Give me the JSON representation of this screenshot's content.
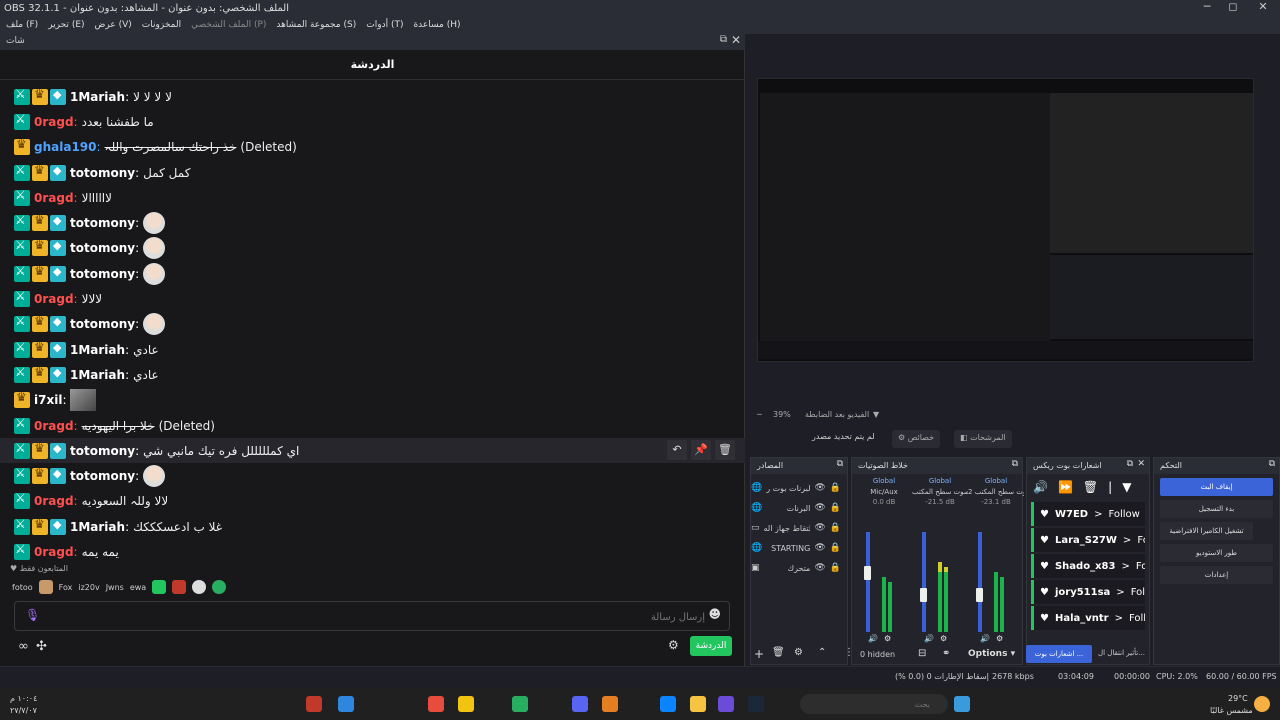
{
  "window": {
    "title": "OBS 32.1.1 - الملف الشخصي: بدون عنوان - المشاهد: بدون عنوان"
  },
  "menu": [
    "ملف (F)",
    "تحرير (E)",
    "عرض (V)",
    "المخزونات",
    "الملف الشخصي (P)",
    "مجموعة المشاهد (S)",
    "أدوات (T)",
    "مساعدة (H)"
  ],
  "chat_dock": {
    "dock_title": "شات",
    "header": "الدردشة",
    "messages": [
      {
        "badges": [
          "mod",
          "crown",
          "vip"
        ],
        "user": "1Mariah",
        "color": "#ffffff",
        "text": "لا لا لا لا",
        "deleted": false
      },
      {
        "badges": [
          "mod"
        ],
        "user": "0ragd",
        "color": "#ff4f4f",
        "text": "ما طفشنا بعدد",
        "deleted": false
      },
      {
        "badges": [
          "crown"
        ],
        "user": "ghala190",
        "color": "#4fa3ff",
        "text": "خذ راحتك سالمصرت واللہ",
        "deleted": true
      },
      {
        "badges": [
          "mod",
          "crown",
          "vip"
        ],
        "user": "totomony",
        "color": "#ffffff",
        "text": "كمل كمل",
        "deleted": false
      },
      {
        "badges": [
          "mod"
        ],
        "user": "0ragd",
        "color": "#ff4f4f",
        "text": "لاااااالا",
        "deleted": false
      },
      {
        "badges": [
          "mod",
          "crown",
          "vip"
        ],
        "user": "totomony",
        "color": "#ffffff",
        "text": "",
        "emote": true,
        "deleted": false
      },
      {
        "badges": [
          "mod",
          "crown",
          "vip"
        ],
        "user": "totomony",
        "color": "#ffffff",
        "text": "",
        "emote": true,
        "deleted": false
      },
      {
        "badges": [
          "mod",
          "crown",
          "vip"
        ],
        "user": "totomony",
        "color": "#ffffff",
        "text": "",
        "emote": true,
        "deleted": false
      },
      {
        "badges": [
          "mod"
        ],
        "user": "0ragd",
        "color": "#ff4f4f",
        "text": "لالالا",
        "deleted": false
      },
      {
        "badges": [
          "mod",
          "crown",
          "vip"
        ],
        "user": "totomony",
        "color": "#ffffff",
        "text": "",
        "emote": true,
        "deleted": false
      },
      {
        "badges": [
          "mod",
          "crown",
          "vip"
        ],
        "user": "1Mariah",
        "color": "#ffffff",
        "text": "عادي",
        "deleted": false
      },
      {
        "badges": [
          "mod",
          "crown",
          "vip"
        ],
        "user": "1Mariah",
        "color": "#ffffff",
        "text": "عادي",
        "deleted": false
      },
      {
        "badges": [
          "crown"
        ],
        "user": "i7xil",
        "color": "#ffffff",
        "text": "",
        "pic": true,
        "deleted": false
      },
      {
        "badges": [
          "mod"
        ],
        "user": "0ragd",
        "color": "#ff4f4f",
        "text": "خلا برا اليهوديه",
        "deleted": true
      },
      {
        "badges": [
          "mod",
          "crown",
          "vip"
        ],
        "user": "totomony",
        "color": "#ffffff",
        "text": "اي كملللللل فره تيك مانبي شي",
        "deleted": false,
        "highlight": true
      },
      {
        "badges": [
          "mod",
          "crown",
          "vip"
        ],
        "user": "totomony",
        "color": "#ffffff",
        "text": "",
        "emote": true,
        "deleted": false
      },
      {
        "badges": [
          "mod"
        ],
        "user": "0ragd",
        "color": "#ff4f4f",
        "text": "لالا وللہ السعوديه",
        "deleted": false
      },
      {
        "badges": [
          "mod",
          "crown",
          "vip"
        ],
        "user": "1Mariah",
        "color": "#ffffff",
        "text": "غلا ب ادعسكككك",
        "deleted": false
      },
      {
        "badges": [
          "mod"
        ],
        "user": "0ragd",
        "color": "#ff4f4f",
        "text": "يمه يمه",
        "deleted": false
      }
    ],
    "deleted_tag": "(Deleted)",
    "subs_label": "المتابعون فقط",
    "emote_row": [
      "fotoo",
      "Fox",
      "iz20v",
      "Jwns",
      "ewa"
    ],
    "input_placeholder": "إرسال رسالة",
    "send_button": "الدردشة"
  },
  "preview": {
    "zoom": "39%",
    "zoom_hint": "الفيديو بعد الضابطة"
  },
  "controls_row": {
    "no_source": "لم يتم تحديد مصدر",
    "props": "خصائص",
    "filters": "المرشحات"
  },
  "sources": {
    "title": "المصادر",
    "items": [
      {
        "name": "البرنات بوت ر",
        "type": "browser"
      },
      {
        "name": "البرنات",
        "type": "browser"
      },
      {
        "name": "التقاط جهاز اله",
        "type": "window"
      },
      {
        "name": "STARTING",
        "type": "browser"
      },
      {
        "name": "متحرك",
        "type": "image"
      }
    ]
  },
  "mixer": {
    "title": "خلاط الصوتيات",
    "channels": [
      {
        "global": "Global",
        "name": "Mic/Aux",
        "db": "0.0 dB",
        "level": 0.55,
        "fader": 0.6
      },
      {
        "global": "Global",
        "name": "صوت سطح المكتب",
        "db": "-21.5 dB",
        "level": 0.7,
        "fader": 0.35
      },
      {
        "global": "Global",
        "name": "صوت سطح المكتب 2",
        "db": "-23.1 dB",
        "level": 0.6,
        "fader": 0.35
      }
    ]
  },
  "alerts": {
    "title": "اشعارات بوت ريكس",
    "items": [
      {
        "user": "W7ED",
        "action": "Follow"
      },
      {
        "user": "Lara_S27W",
        "action": "Follow"
      },
      {
        "user": "Shado_x83",
        "action": "Follow"
      },
      {
        "user": "jory511sa",
        "action": "Follow"
      },
      {
        "user": "Hala_vntr",
        "action": "Follow"
      }
    ]
  },
  "controls": {
    "title": "التحكم",
    "buttons": [
      "إيقاف البث",
      "بدء التسجيل",
      "تشغيل الكاميرا الافتراضية",
      "طور الاستوديو",
      "إعدادات"
    ]
  },
  "dock_footer": {
    "hidden": "0 hidden",
    "options": "Options",
    "alerts_tab": "اشعارات بوت ...",
    "transition": "تأثير انتقال ال..."
  },
  "status": {
    "dropped": "إسقاط الإطارات 0 (0.0 %)",
    "bitrate": "2678 kbps",
    "live_time": "03:04:09",
    "rec_time": "00:00:00",
    "cpu": "CPU: 2.0%",
    "fps": "60.00 / 60.00 FPS"
  },
  "taskbar": {
    "search": "بحث",
    "weather_temp": "29°C",
    "weather_text": "مشمس غالبًا",
    "time": "١٠:٠٤ م",
    "date": "٢٧/٧/٠٧"
  }
}
